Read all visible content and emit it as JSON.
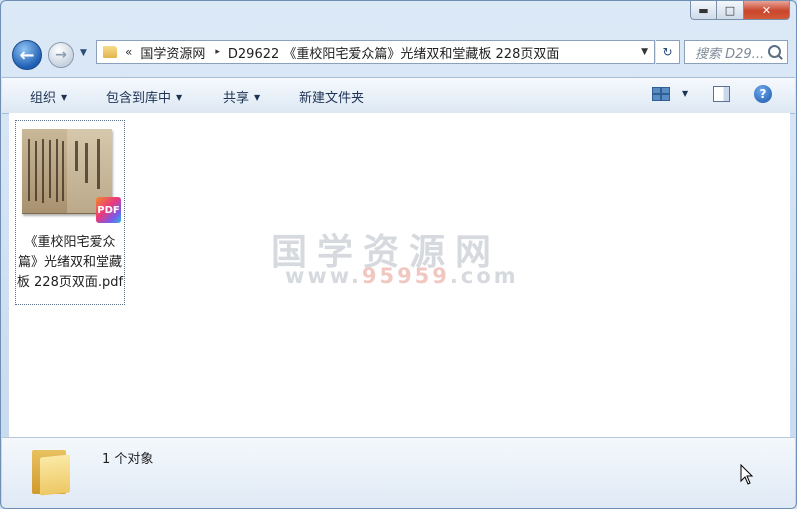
{
  "window": {
    "caption": {
      "minimize": "▬",
      "maximize": "□",
      "close": "✕"
    }
  },
  "nav": {
    "back_icon": "←",
    "forward_icon": "→",
    "history_icon": "▼",
    "overflow": "«",
    "breadcrumbs": [
      "国学资源网",
      "D29622 《重校阳宅爱众篇》光绪双和堂藏板 228页双面"
    ],
    "separator": "▸",
    "dropdown": "▼",
    "refresh": "↻",
    "search_placeholder": "搜索 D29..."
  },
  "commands": {
    "organize": "组织",
    "include_library": "包含到库中",
    "share": "共享",
    "new_folder": "新建文件夹",
    "arrow": "▼",
    "help": "?"
  },
  "files": [
    {
      "name": "《重校阳宅爱众篇》光绪双和堂藏板 228页双面.pdf",
      "badge": "PDF"
    }
  ],
  "watermark": {
    "title": "国学资源网",
    "url_prefix": "www.",
    "url_highlight": "95959",
    "url_suffix": ".com"
  },
  "status": {
    "count_text": "1 个对象"
  },
  "colors": {
    "accent": "#1f5fb3",
    "close_button": "#c9462c",
    "watermark": "#d6d9dd",
    "watermark_highlight": "#f1c8c1"
  }
}
